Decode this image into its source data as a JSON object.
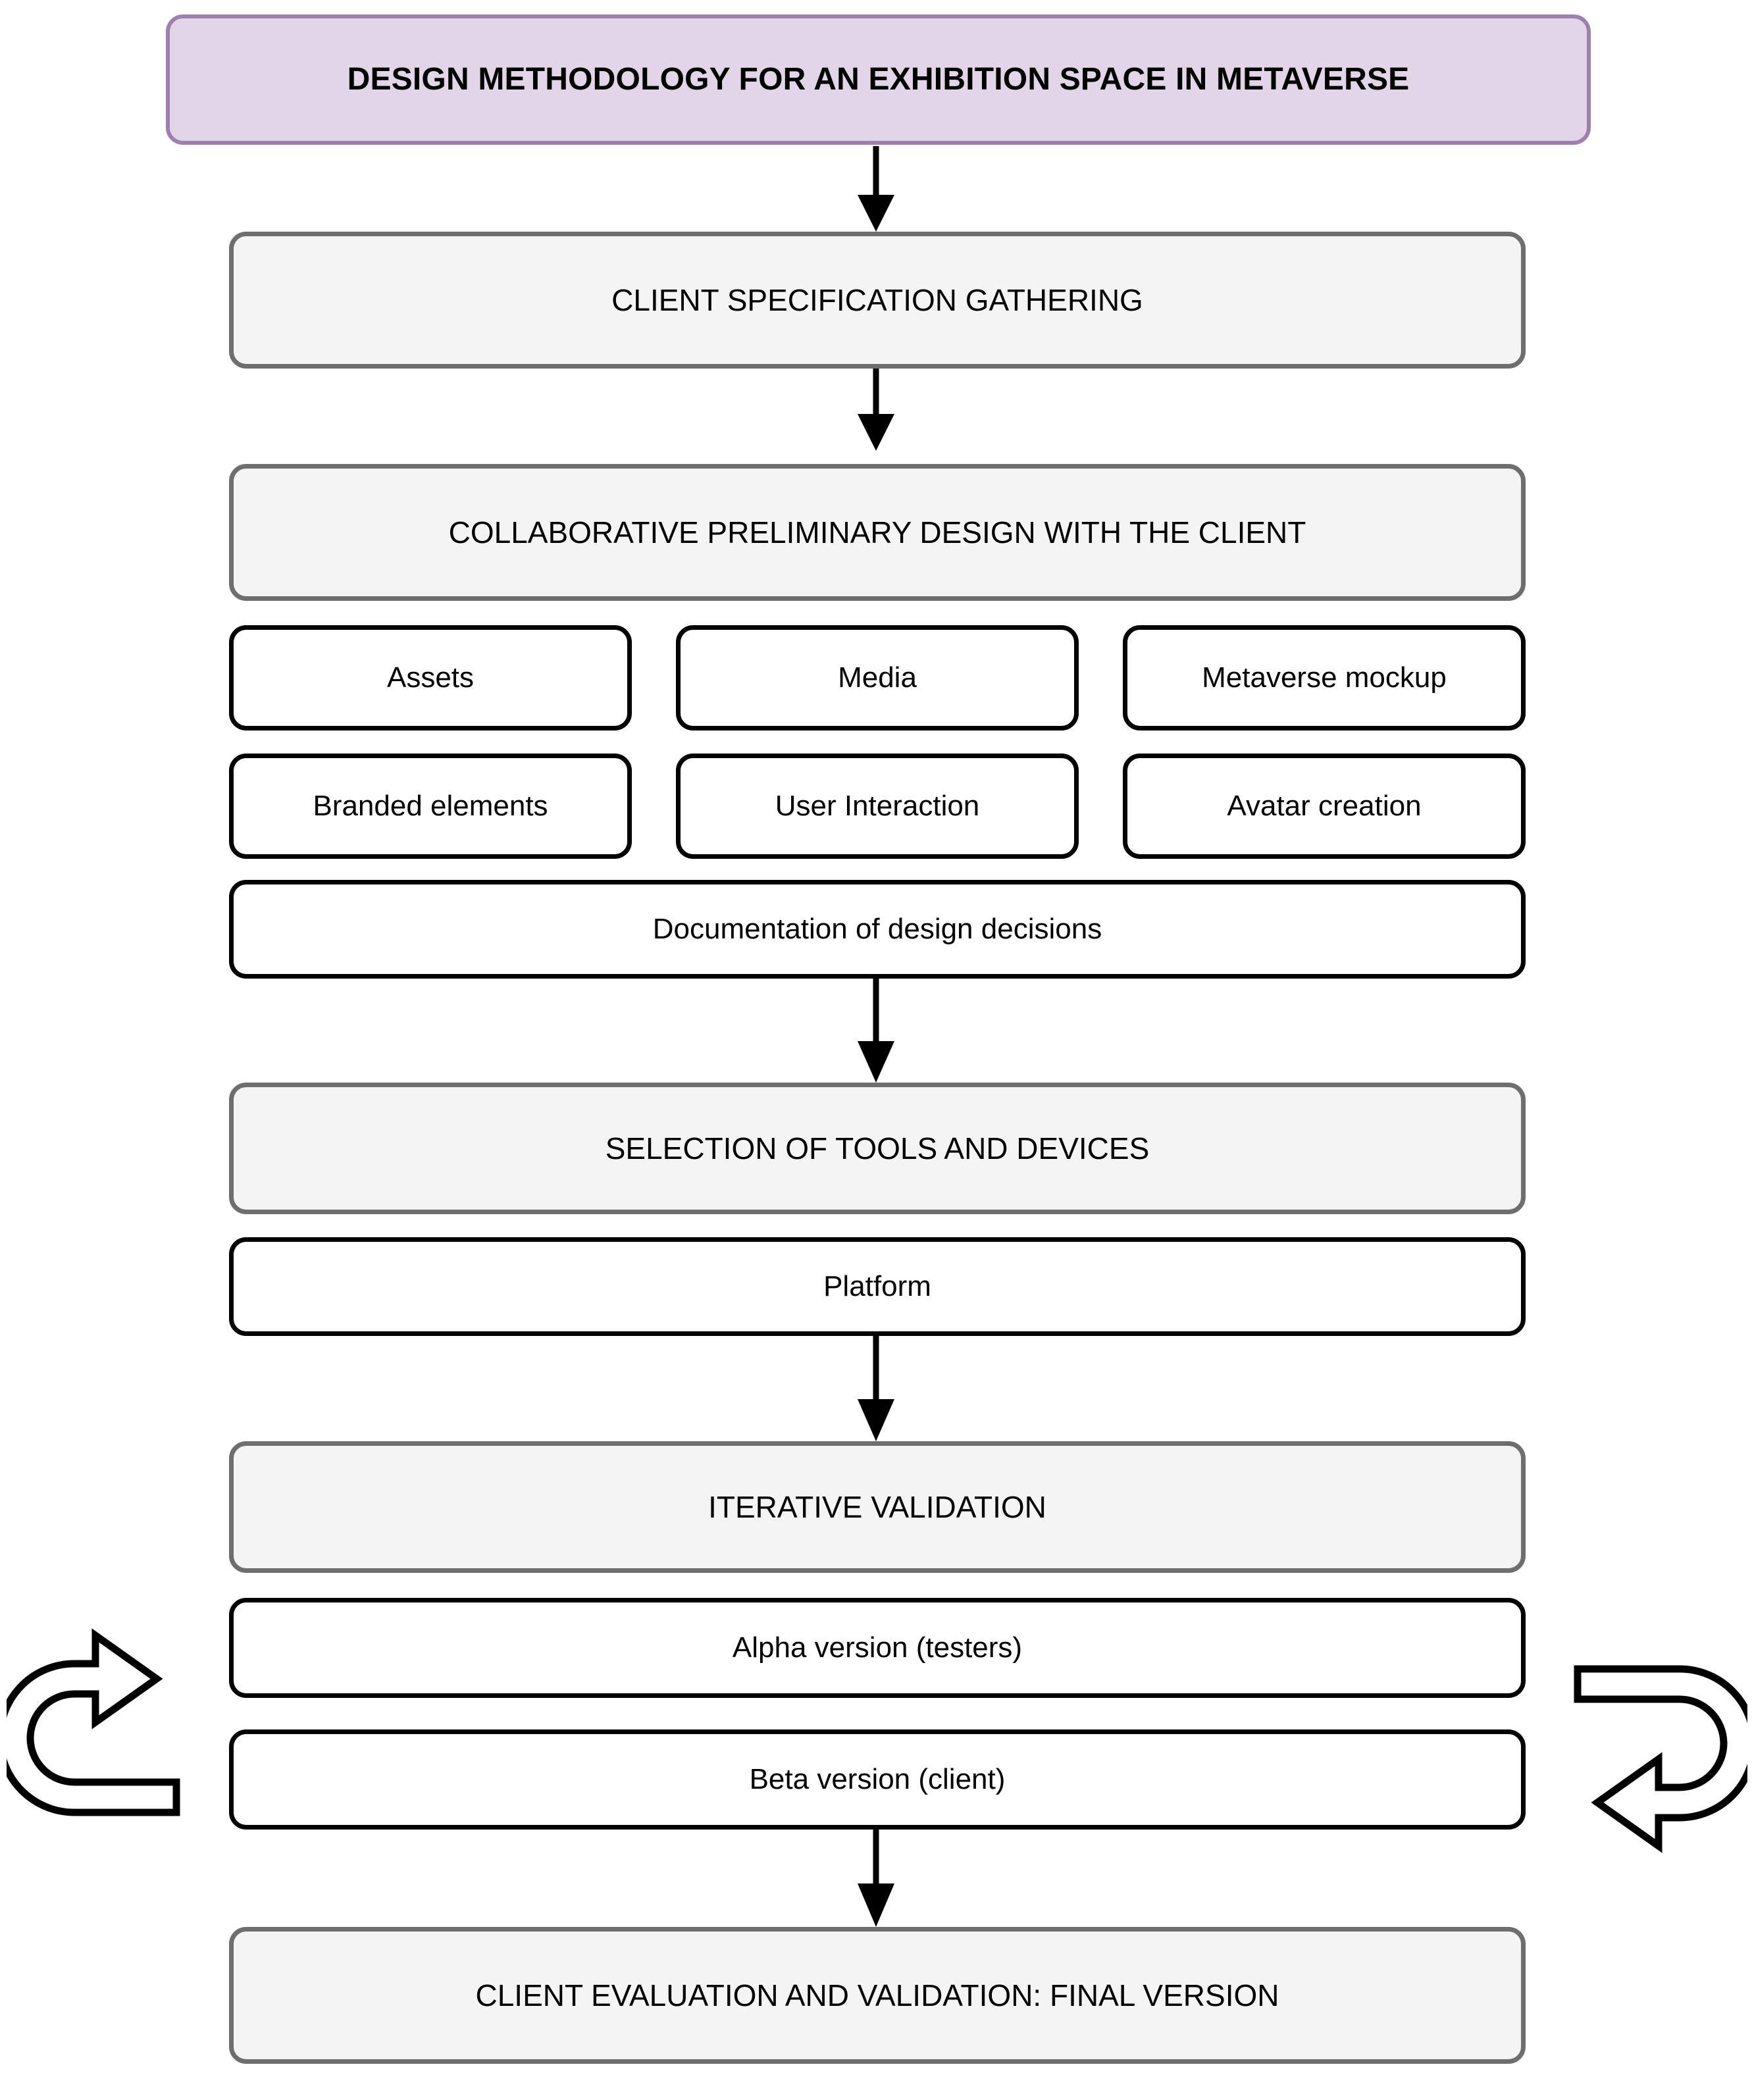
{
  "diagram": {
    "title": "DESIGN METHODOLOGY FOR AN EXHIBITION SPACE IN METAVERSE",
    "colors": {
      "title_fill": "#e3d5e8",
      "title_border": "#9f7fae",
      "stage_fill": "#f4f4f4",
      "stage_border": "#6e6e6e",
      "detail_fill": "#ffffff",
      "detail_border": "#000000",
      "arrow": "#000000",
      "background": "#ffffff"
    },
    "stages": [
      {
        "id": "client-specification-gathering",
        "label": "CLIENT SPECIFICATION GATHERING"
      },
      {
        "id": "collaborative-preliminary-design",
        "label": "COLLABORATIVE PRELIMINARY DESIGN WITH THE CLIENT"
      },
      {
        "id": "selection-of-tools-and-devices",
        "label": "SELECTION OF TOOLS AND DEVICES"
      },
      {
        "id": "iterative-validation",
        "label": "ITERATIVE VALIDATION"
      },
      {
        "id": "client-evaluation-final-version",
        "label": "CLIENT EVALUATION AND VALIDATION: FINAL VERSION"
      }
    ],
    "design_details": {
      "row1": [
        {
          "id": "assets",
          "label": "Assets"
        },
        {
          "id": "media",
          "label": "Media"
        },
        {
          "id": "metaverse-mockup",
          "label": "Metaverse mockup"
        }
      ],
      "row2": [
        {
          "id": "branded-elements",
          "label": "Branded elements"
        },
        {
          "id": "user-interaction",
          "label": "User Interaction"
        },
        {
          "id": "avatar-creation",
          "label": "Avatar creation"
        }
      ],
      "full_width": {
        "id": "documentation-of-design-decisions",
        "label": "Documentation of design decisions"
      }
    },
    "tools_details": [
      {
        "id": "platform",
        "label": "Platform"
      }
    ],
    "validation_details": [
      {
        "id": "alpha-version",
        "label": "Alpha version (testers)"
      },
      {
        "id": "beta-version",
        "label": "Beta version (client)"
      }
    ],
    "loop_icons": [
      {
        "id": "loop-arrow-left",
        "name": "loop-arrow-left-icon",
        "direction": "clockwise-right"
      },
      {
        "id": "loop-arrow-right",
        "name": "loop-arrow-right-icon",
        "direction": "clockwise-left"
      }
    ],
    "connectors": [
      {
        "id": "title-to-stage1"
      },
      {
        "id": "stage1-to-stage2"
      },
      {
        "id": "documentation-to-stage3"
      },
      {
        "id": "platform-to-stage4"
      },
      {
        "id": "beta-to-stage5"
      }
    ]
  }
}
